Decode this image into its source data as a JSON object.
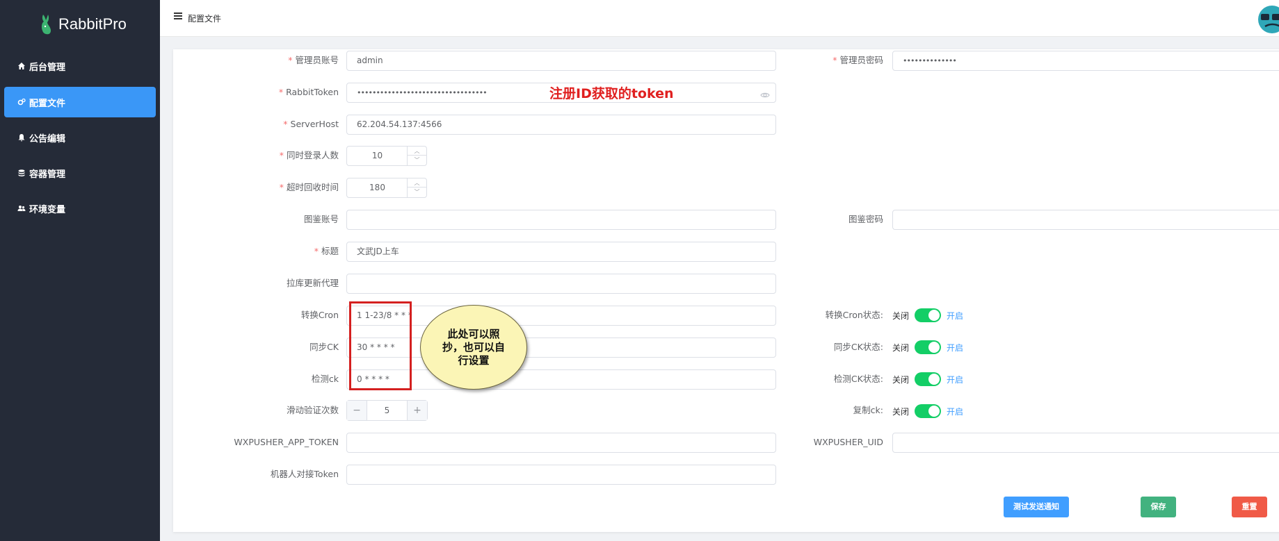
{
  "app": {
    "name": "RabbitPro"
  },
  "sidebar": {
    "items": [
      {
        "label": "后台管理",
        "icon": "home-icon"
      },
      {
        "label": "配置文件",
        "icon": "gears-icon",
        "active": true
      },
      {
        "label": "公告编辑",
        "icon": "bell-icon"
      },
      {
        "label": "容器管理",
        "icon": "database-icon"
      },
      {
        "label": "环境变量",
        "icon": "users-icon"
      }
    ]
  },
  "header": {
    "breadcrumb": "配置文件"
  },
  "form": {
    "admin_account_label": "管理员账号",
    "admin_account_value": "admin",
    "admin_password_label": "管理员密码",
    "admin_password_value": "••••••••••••••",
    "rabbit_token_label": "RabbitToken",
    "rabbit_token_value": "••••••••••••••••••••••••••••••••••",
    "server_host_label": "ServerHost",
    "server_host_value": "62.204.54.137:4566",
    "concurrent_login_label": "同时登录人数",
    "concurrent_login_value": "10",
    "timeout_recycle_label": "超时回收时间",
    "timeout_recycle_value": "180",
    "tujian_account_label": "图鉴账号",
    "tujian_account_value": "",
    "tujian_password_label": "图鉴密码",
    "tujian_password_value": "",
    "title_label": "标题",
    "title_value": "文武JD上车",
    "pull_proxy_label": "拉库更新代理",
    "pull_proxy_value": "",
    "convert_cron_label": "转换Cron",
    "convert_cron_value": "1 1-23/8 * * *",
    "sync_ck_label": "同步CK",
    "sync_ck_value": "30 * * * *",
    "check_ck_label": "检测ck",
    "check_ck_value": "0 * * * *",
    "slide_verify_label": "滑动验证次数",
    "slide_verify_value": "5",
    "wxpusher_token_label": "WXPUSHER_APP_TOKEN",
    "wxpusher_token_value": "",
    "wxpusher_uid_label": "WXPUSHER_UID",
    "wxpusher_uid_value": "",
    "bot_token_label": "机器人对接Token",
    "bot_token_value": ""
  },
  "switches": [
    {
      "label": "转换Cron状态:",
      "off": "关闭",
      "on": "开启",
      "state": true
    },
    {
      "label": "同步CK状态:",
      "off": "关闭",
      "on": "开启",
      "state": true
    },
    {
      "label": "检测CK状态:",
      "off": "关闭",
      "on": "开启",
      "state": true
    },
    {
      "label": "复制ck:",
      "off": "关闭",
      "on": "开启",
      "state": true
    }
  ],
  "buttons": {
    "test_notify": "测试发送通知",
    "save": "保存",
    "reset": "重置"
  },
  "annotations": {
    "token_note": "注册ID获取的token",
    "cron_note": "此处可以照抄，也可以自行设置"
  },
  "colors": {
    "sidebar_bg": "#252b38",
    "active_nav": "#3a97f7",
    "switch_on": "#13ce66",
    "annotation_red": "#e02020"
  }
}
